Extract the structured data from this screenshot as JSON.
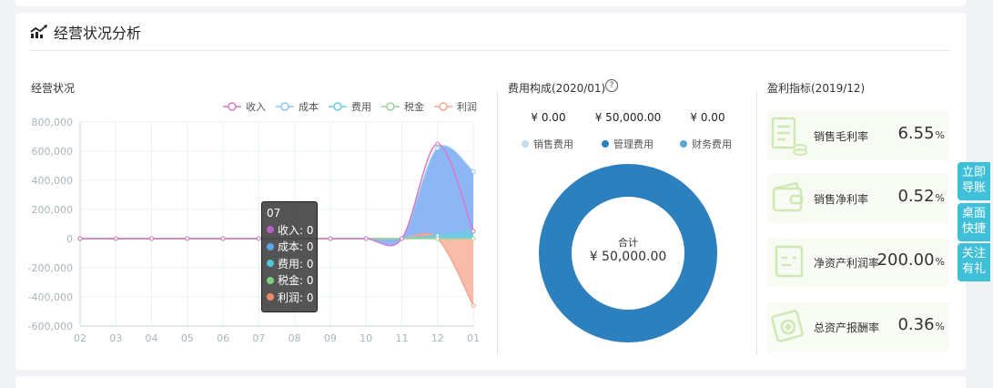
{
  "section": {
    "title": "经营状况分析",
    "icon": "trend-chart-icon"
  },
  "operation_panel": {
    "title": "经营状况"
  },
  "expense_panel": {
    "title": "费用构成(2020/01)",
    "help_icon": "question-circle-icon",
    "help_glyph": "?",
    "amounts": [
      "¥ 0.00",
      "¥ 50,000.00",
      "¥ 0.00"
    ],
    "legend": [
      {
        "name": "销售费用",
        "color": "#c3dcf0"
      },
      {
        "name": "管理费用",
        "color": "#2c80bd"
      },
      {
        "name": "财务费用",
        "color": "#5ba6d9"
      }
    ],
    "donut_center_label": "合计",
    "donut_center_value": "¥ 50,000.00"
  },
  "indicator_panel": {
    "title": "盈利指标(2019/12)",
    "items": [
      {
        "label": "销售毛利率",
        "value": "6.55",
        "unit": "%",
        "icon": "invoice-coins-icon"
      },
      {
        "label": "销售净利率",
        "value": "0.52",
        "unit": "%",
        "icon": "wallet-icon"
      },
      {
        "label": "净资产利润率",
        "value": "200.00",
        "unit": "%",
        "icon": "scroll-icon"
      },
      {
        "label": "总资产报酬率",
        "value": "0.36",
        "unit": "%",
        "icon": "stamp-icon"
      }
    ]
  },
  "side_buttons": [
    {
      "label": "立即导账"
    },
    {
      "label": "桌面快捷"
    },
    {
      "label": "关注有礼"
    }
  ],
  "tooltip": {
    "title": "07",
    "rows": [
      {
        "label": "收入: 0",
        "color": "#b561c7"
      },
      {
        "label": "成本: 0",
        "color": "#5aa8e8"
      },
      {
        "label": "费用: 0",
        "color": "#4fc7d6"
      },
      {
        "label": "税金: 0",
        "color": "#7ccf7c"
      },
      {
        "label": "利润: 0",
        "color": "#f08a6c"
      }
    ]
  },
  "chart_data": {
    "type": "area",
    "categories": [
      "02",
      "03",
      "04",
      "05",
      "06",
      "07",
      "08",
      "09",
      "10",
      "11",
      "12",
      "01"
    ],
    "yticks": [
      "800,000",
      "600,000",
      "400,000",
      "200,000",
      "0",
      "-200,000",
      "-400,000",
      "-600,000"
    ],
    "ylim": [
      -600000,
      800000
    ],
    "grid": true,
    "legend_position": "top-right",
    "series": [
      {
        "name": "收入",
        "color": "#d778c8",
        "fill": "none",
        "values": [
          0,
          0,
          0,
          0,
          0,
          0,
          0,
          0,
          0,
          0,
          650000,
          50000
        ]
      },
      {
        "name": "成本",
        "color": "#8ec7ef",
        "fill": "#6a9ef0",
        "values": [
          0,
          0,
          0,
          0,
          0,
          0,
          0,
          0,
          0,
          0,
          620000,
          460000
        ]
      },
      {
        "name": "费用",
        "color": "#66d0dd",
        "fill": "#66d0dd",
        "values": [
          0,
          0,
          0,
          0,
          0,
          0,
          0,
          0,
          0,
          0,
          20000,
          50000
        ]
      },
      {
        "name": "税金",
        "color": "#9ad39a",
        "fill": "none",
        "values": [
          0,
          0,
          0,
          0,
          0,
          0,
          0,
          0,
          0,
          0,
          0,
          0
        ]
      },
      {
        "name": "利润",
        "color": "#f6a58c",
        "fill": "#f6a58c",
        "values": [
          0,
          0,
          0,
          0,
          0,
          0,
          0,
          0,
          0,
          0,
          0,
          -460000
        ]
      }
    ]
  }
}
